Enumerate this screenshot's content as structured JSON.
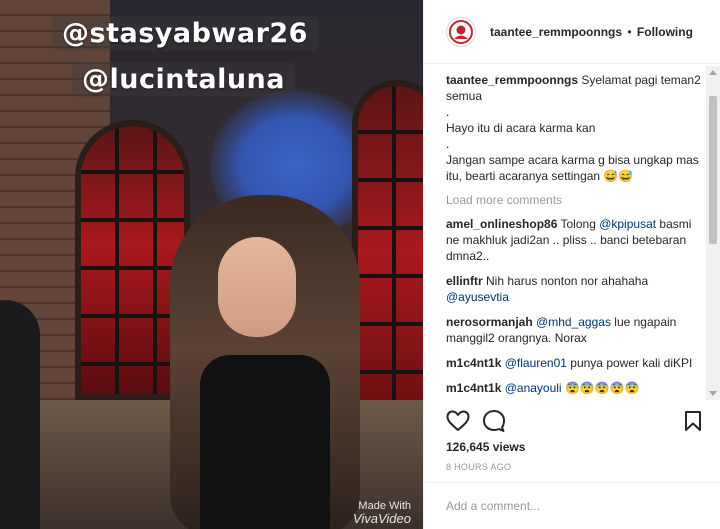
{
  "media": {
    "overlay_tags": [
      "@stasyabwar26",
      "@lucintaluna"
    ],
    "watermark_line1": "Made With",
    "watermark_line2": "VivaVideo"
  },
  "header": {
    "username": "taantee_remmpoonngs",
    "separator": "•",
    "follow_status": "Following"
  },
  "caption": {
    "username": "taantee_remmpoonngs",
    "lines": [
      "Syelamat pagi teman2 semua",
      ".",
      "Hayo itu di acara karma kan",
      ".",
      "Jangan sampe acara karma g bisa ungkap mas itu, bearti acaranya settingan 😅😅"
    ]
  },
  "load_more_label": "Load more comments",
  "comments": [
    {
      "username": "amel_onlineshop86",
      "pre": "Tolong ",
      "mention": "@kpipusat",
      "post": " basmi ne makhluk jadi2an .. pliss .. banci betebaran dmna2.."
    },
    {
      "username": "ellinftr",
      "pre": "Nih harus nonton nor ahahaha ",
      "mention": "@ayusevtia",
      "post": ""
    },
    {
      "username": "nerosormanjah",
      "pre": "",
      "mention": "@mhd_aggas",
      "post": " lue ngapain manggil2 orangnya. Norax"
    },
    {
      "username": "m1c4nt1k",
      "pre": "",
      "mention": "@flauren01",
      "post": " punya power kali diKPI"
    },
    {
      "username": "m1c4nt1k",
      "pre": "",
      "mention": "@anayouli",
      "post": " 😨😨😨😨😨"
    }
  ],
  "actions": {
    "like_icon": "heart-outline-icon",
    "comment_icon": "speech-bubble-icon",
    "save_icon": "bookmark-icon"
  },
  "views": "126,645 views",
  "timestamp": "8 HOURS AGO",
  "add_comment_placeholder": "Add a comment...",
  "colors": {
    "mention": "#003569",
    "muted": "#999999",
    "text": "#262626"
  }
}
